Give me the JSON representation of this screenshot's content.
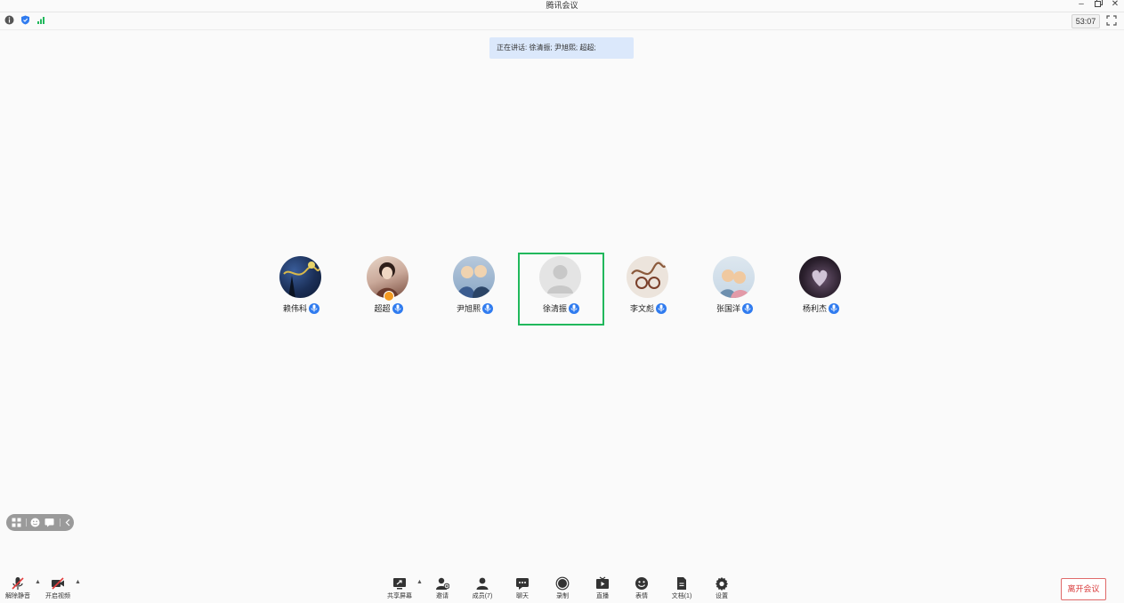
{
  "window": {
    "title": "腾讯会议"
  },
  "status": {
    "timer": "53:07"
  },
  "speaking_banner": {
    "prefix": "正在讲话:",
    "names": "徐清振; 尹旭熙; 超超;"
  },
  "participants": [
    {
      "name": "赖伟科",
      "avatar_colors": [
        "#1b2f57",
        "#3a5d9a",
        "#d9b94a"
      ]
    },
    {
      "name": "超超",
      "avatar_colors": [
        "#caa99a",
        "#5a3a30",
        "#e8d6c8"
      ]
    },
    {
      "name": "尹旭熙",
      "avatar_colors": [
        "#8aa7c6",
        "#f0d3b0",
        "#3b5c8f"
      ]
    },
    {
      "name": "徐清振",
      "avatar_colors": [
        "#e4e4e4",
        "#c8c8c8",
        "#ffffff"
      ]
    },
    {
      "name": "李文彪",
      "avatar_colors": [
        "#e8ded4",
        "#8b5a3c",
        "#c4a48a"
      ]
    },
    {
      "name": "张国洋",
      "avatar_colors": [
        "#c8d8e6",
        "#f0c9a0",
        "#6d8fae"
      ]
    },
    {
      "name": "杨利杰",
      "avatar_colors": [
        "#1e1620",
        "#6b5570",
        "#d0c3d6"
      ]
    }
  ],
  "toolbar": {
    "unmute": "解除静音",
    "start_video": "开启视频",
    "share_screen": "共享屏幕",
    "invite": "邀请",
    "members": "成员(7)",
    "chat": "聊天",
    "record": "录制",
    "live": "直播",
    "reactions": "表情",
    "docs": "文档(1)",
    "settings": "设置",
    "leave": "离开会议"
  },
  "colors": {
    "accent": "#2f7bef",
    "active_speaker": "#21b85c",
    "leave": "#d93b3b",
    "banner": "#dbe8fb"
  }
}
